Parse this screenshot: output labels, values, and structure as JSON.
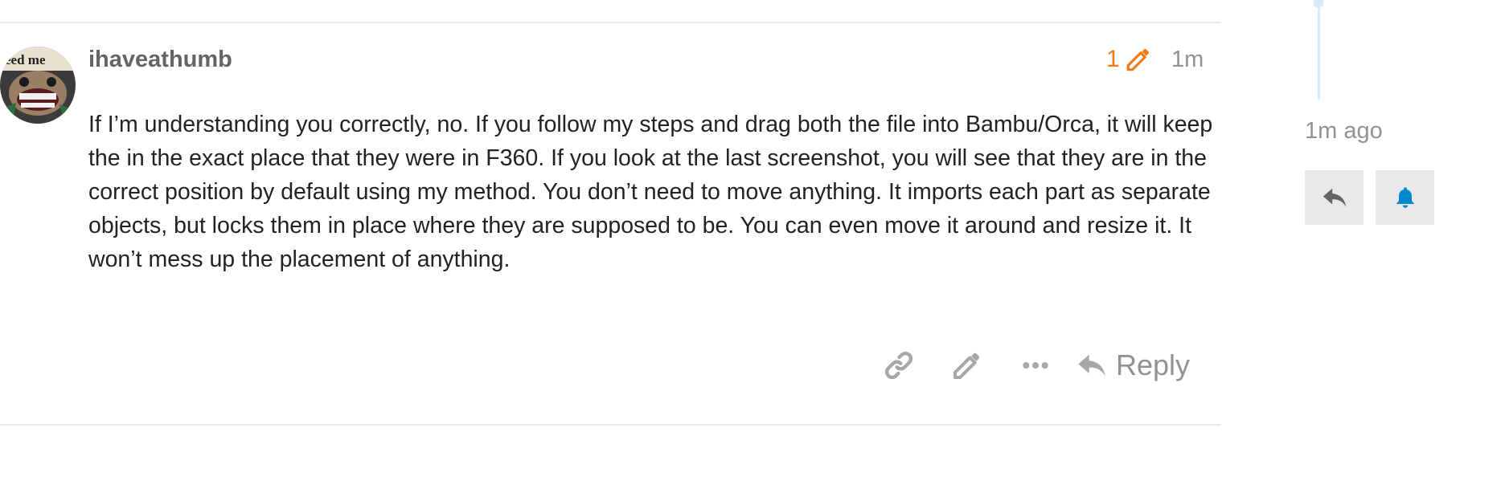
{
  "post": {
    "username": "ihaveathumb",
    "edit_count": "1",
    "age": "1m",
    "body": "If I’m understanding you correctly, no. If you follow my steps and drag both the file into Bambu/Orca, it will keep the in the exact place that they were in F360. If you look at the last screenshot, you will see that they are in the correct position by default using my method. You don’t need to move anything. It imports each part as separate objects, but locks them in place where they are supposed to be. You can even move it around and resize it. It won’t mess up the placement of anything.",
    "avatar_text": "eed me"
  },
  "actions": {
    "reply_label": "Reply",
    "icons": [
      "link-icon",
      "pencil-icon",
      "ellipsis-icon",
      "reply-icon"
    ]
  },
  "timeline": {
    "ago": "1m ago",
    "icons": [
      "reply-icon",
      "bell-icon"
    ]
  },
  "colors": {
    "edit_accent": "#f07a16",
    "muted": "#919191",
    "bell": "#0088cc",
    "timeline": "#d6ecf8",
    "divider": "#e9e9e9"
  }
}
